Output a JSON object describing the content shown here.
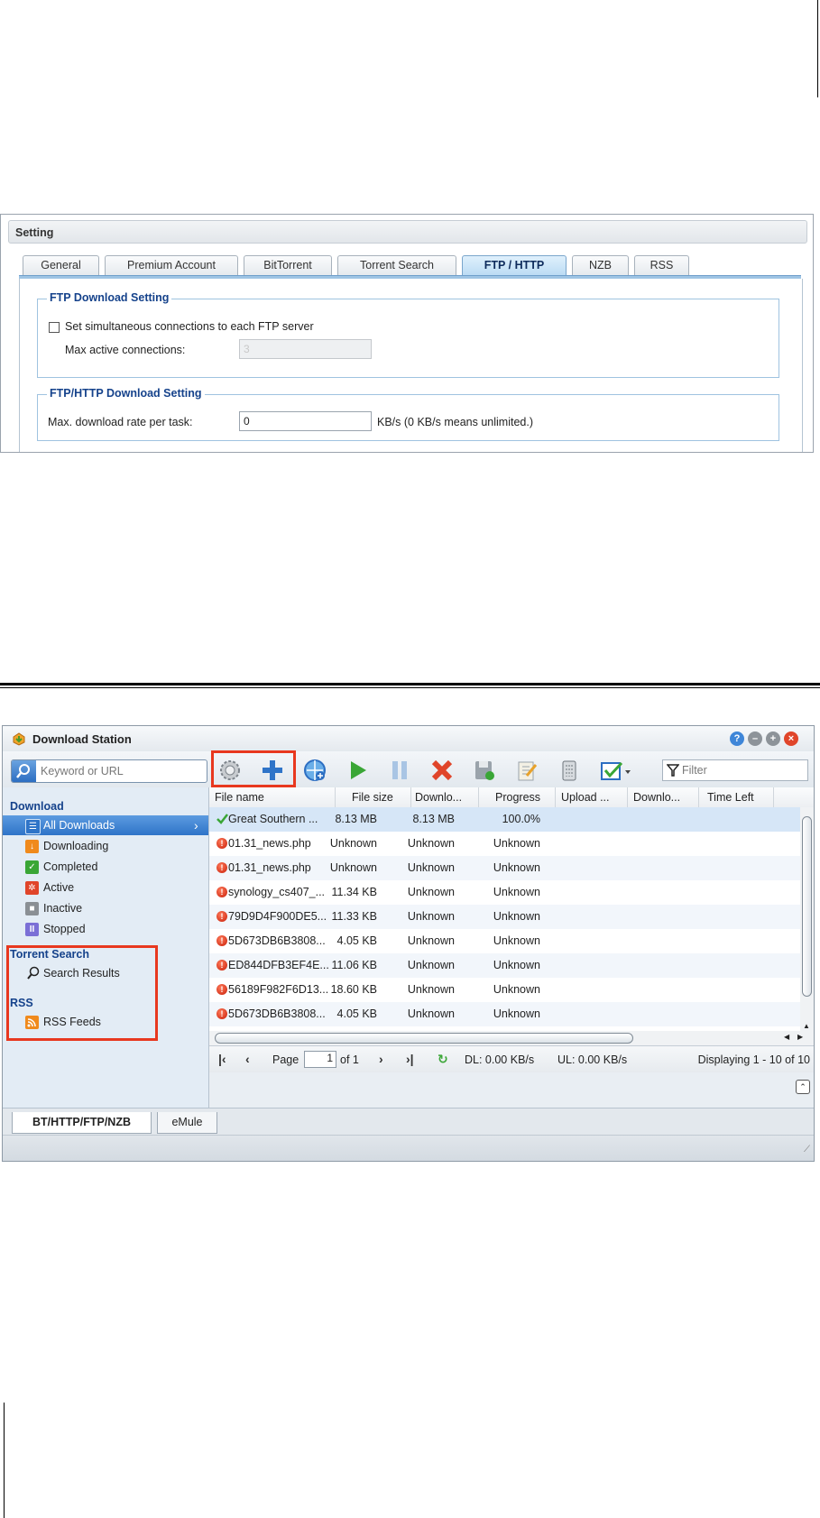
{
  "settings": {
    "title": "Setting",
    "tabs": [
      "General",
      "Premium Account",
      "BitTorrent",
      "Torrent Search",
      "FTP / HTTP",
      "NZB",
      "RSS"
    ],
    "active_tab": "FTP / HTTP",
    "ftp_section": {
      "legend": "FTP Download Setting",
      "checkbox_label": "Set simultaneous connections to each FTP server",
      "checkbox_checked": false,
      "max_conn_label": "Max active connections:",
      "max_conn_value": "3"
    },
    "ftphttp_section": {
      "legend": "FTP/HTTP Download Setting",
      "rate_label": "Max. download rate per task:",
      "rate_value": "0",
      "rate_unit": "KB/s (0 KB/s means unlimited.)"
    }
  },
  "download_station": {
    "title": "Download Station",
    "search_placeholder": "Keyword or URL",
    "filter_placeholder": "Filter",
    "toolbar_icons": [
      "gear-icon",
      "plus-icon",
      "globe-add-icon",
      "play-icon",
      "pause-icon",
      "delete-icon",
      "save-icon",
      "edit-icon",
      "clear-icon",
      "select-icon"
    ],
    "sidebar": {
      "download_header": "Download",
      "items": [
        {
          "label": "All Downloads",
          "color": "#2f74c8",
          "glyph": "☰"
        },
        {
          "label": "Downloading",
          "color": "#f08a1c",
          "glyph": "↓"
        },
        {
          "label": "Completed",
          "color": "#3aa636",
          "glyph": "✓"
        },
        {
          "label": "Active",
          "color": "#e0452a",
          "glyph": "✲"
        },
        {
          "label": "Inactive",
          "color": "#8a8f94",
          "glyph": "■"
        },
        {
          "label": "Stopped",
          "color": "#7b6fd6",
          "glyph": "II"
        }
      ],
      "torrent_header": "Torrent Search",
      "search_results": "Search Results",
      "rss_header": "RSS",
      "rss_feeds": "RSS Feeds"
    },
    "columns": [
      "File name",
      "File size",
      "Downlo...",
      "Progress",
      "Upload ...",
      "Downlo...",
      "Time Left"
    ],
    "rows": [
      {
        "name": "Great Southern ...",
        "size": "8.13 MB",
        "downloaded": "8.13 MB",
        "progress": "100.0%",
        "status": "completed"
      },
      {
        "name": "01.31_news.php",
        "size": "Unknown",
        "downloaded": "Unknown",
        "progress": "Unknown",
        "status": "error"
      },
      {
        "name": "01.31_news.php",
        "size": "Unknown",
        "downloaded": "Unknown",
        "progress": "Unknown",
        "status": "error"
      },
      {
        "name": "synology_cs407_...",
        "size": "11.34 KB",
        "downloaded": "Unknown",
        "progress": "Unknown",
        "status": "error"
      },
      {
        "name": "79D9D4F900DE5...",
        "size": "11.33 KB",
        "downloaded": "Unknown",
        "progress": "Unknown",
        "status": "error"
      },
      {
        "name": "5D673DB6B3808...",
        "size": "4.05 KB",
        "downloaded": "Unknown",
        "progress": "Unknown",
        "status": "error"
      },
      {
        "name": "ED844DFB3EF4E...",
        "size": "11.06 KB",
        "downloaded": "Unknown",
        "progress": "Unknown",
        "status": "error"
      },
      {
        "name": "56189F982F6D13...",
        "size": "18.60 KB",
        "downloaded": "Unknown",
        "progress": "Unknown",
        "status": "error"
      },
      {
        "name": "5D673DB6B3808...",
        "size": "4.05 KB",
        "downloaded": "Unknown",
        "progress": "Unknown",
        "status": "error"
      }
    ],
    "pager": {
      "page_label": "Page",
      "page_value": "1",
      "of_label": "of 1",
      "dl": "DL: 0.00 KB/s",
      "ul": "UL: 0.00 KB/s",
      "displaying": "Displaying 1 - 10 of 10"
    },
    "bottom_tabs": [
      "BT/HTTP/FTP/NZB",
      "eMule"
    ]
  }
}
